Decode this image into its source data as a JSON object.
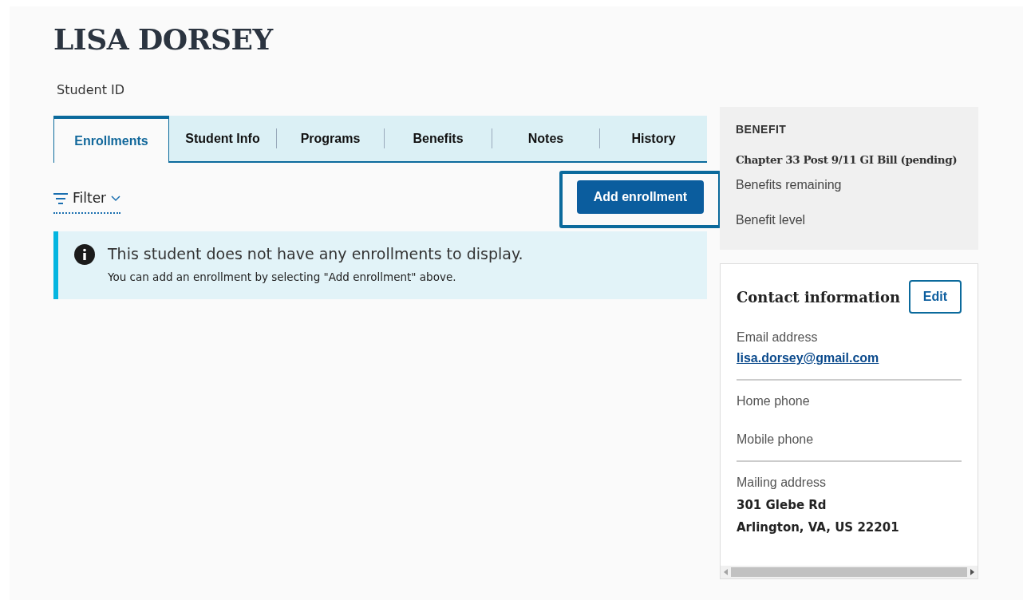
{
  "student": {
    "name": "LISA DORSEY",
    "id_label": "Student ID"
  },
  "tabs": [
    {
      "label": "Enrollments",
      "selected": true
    },
    {
      "label": "Student Info",
      "selected": false
    },
    {
      "label": "Programs",
      "selected": false
    },
    {
      "label": "Benefits",
      "selected": false
    },
    {
      "label": "Notes",
      "selected": false
    },
    {
      "label": "History",
      "selected": false
    }
  ],
  "filter": {
    "label": "Filter"
  },
  "add_button": {
    "label": "Add enrollment",
    "focused": true
  },
  "alert": {
    "title": "This student does not have any enrollments to display.",
    "message": "You can add an enrollment by selecting \"Add enrollment\" above."
  },
  "benefit": {
    "heading": "BENEFIT",
    "title": "Chapter 33 Post 9/11 GI Bill (pending)",
    "fields": [
      "Benefits remaining",
      "Benefit level"
    ]
  },
  "contact": {
    "title": "Contact information",
    "edit_button": "Edit",
    "sections": [
      {
        "fields": [
          {
            "label": "Email address",
            "kind": "link",
            "lines": [
              "lisa.dorsey@gmail.com"
            ]
          }
        ]
      },
      {
        "fields": [
          {
            "label": "Home phone"
          },
          {
            "label": "Mobile phone"
          }
        ]
      },
      {
        "fields": [
          {
            "label": "Mailing address",
            "kind": "text",
            "lines": [
              "301 Glebe Rd",
              "Arlington, VA, US 22201"
            ]
          }
        ]
      }
    ]
  }
}
